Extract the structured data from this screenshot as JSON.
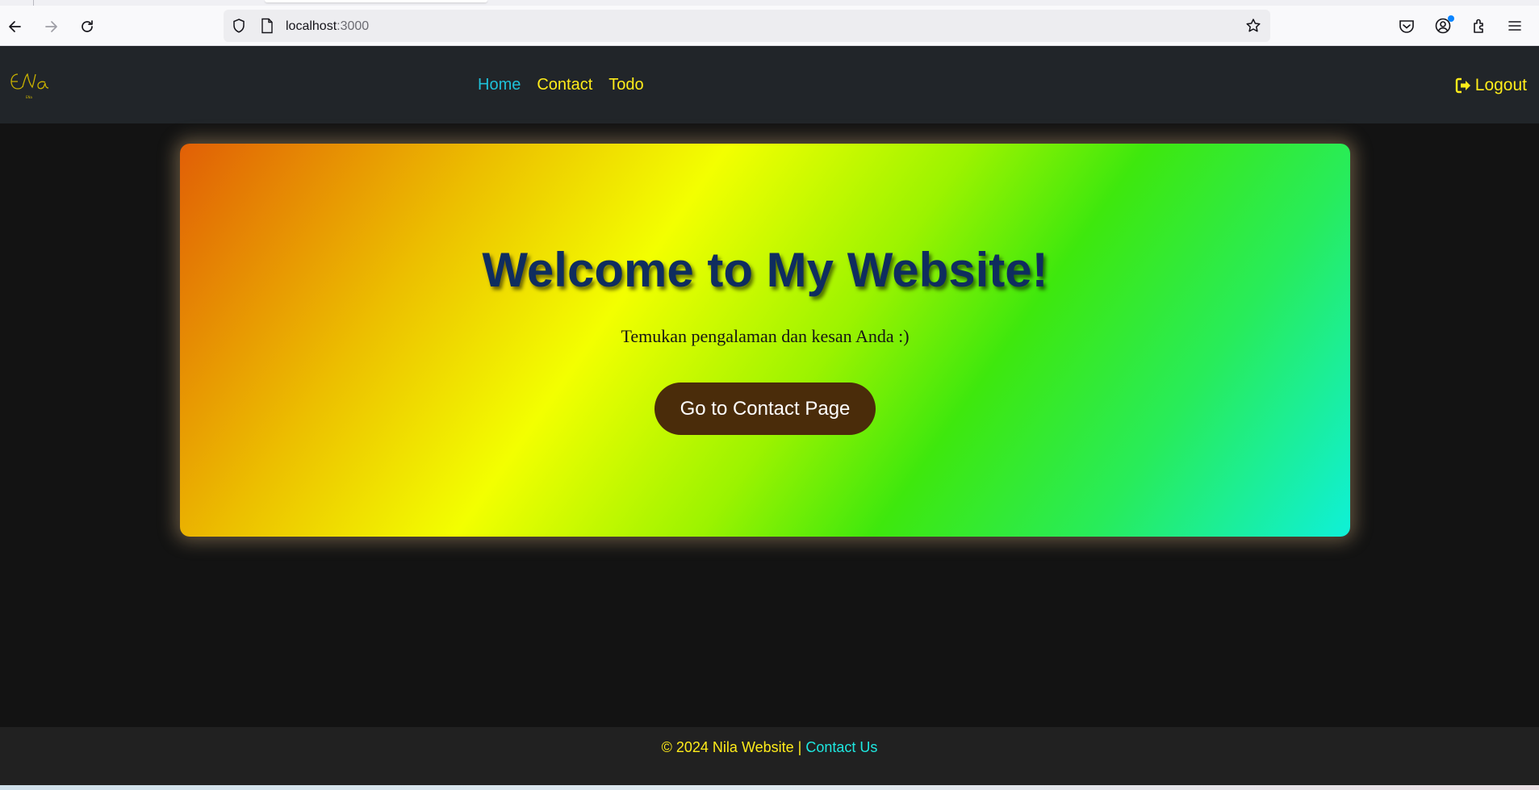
{
  "browser": {
    "url_host": "localhost",
    "url_port": ":3000",
    "icons": [
      "back-icon",
      "forward-icon",
      "reload-icon",
      "shield-icon",
      "page-icon",
      "bookmark-star-icon",
      "pocket-icon",
      "account-icon",
      "extensions-icon",
      "menu-icon"
    ]
  },
  "navbar": {
    "logo_text": "ENa",
    "links": [
      {
        "label": "Home",
        "active": true
      },
      {
        "label": "Contact",
        "active": false
      },
      {
        "label": "Todo",
        "active": false
      }
    ],
    "logout_label": "Logout",
    "colors": {
      "background": "#212529",
      "link": "#ffec1a",
      "active": "#1ec0d8"
    }
  },
  "hero": {
    "title": "Welcome to My Website!",
    "subtitle": "Temukan pengalaman dan kesan Anda :)",
    "button_label": "Go to Contact Page",
    "colors": {
      "title": "#0f2d5f",
      "button": "#4a2c0a"
    }
  },
  "footer": {
    "text": "© 2024 Nila Website | ",
    "link_label": "Contact Us"
  }
}
